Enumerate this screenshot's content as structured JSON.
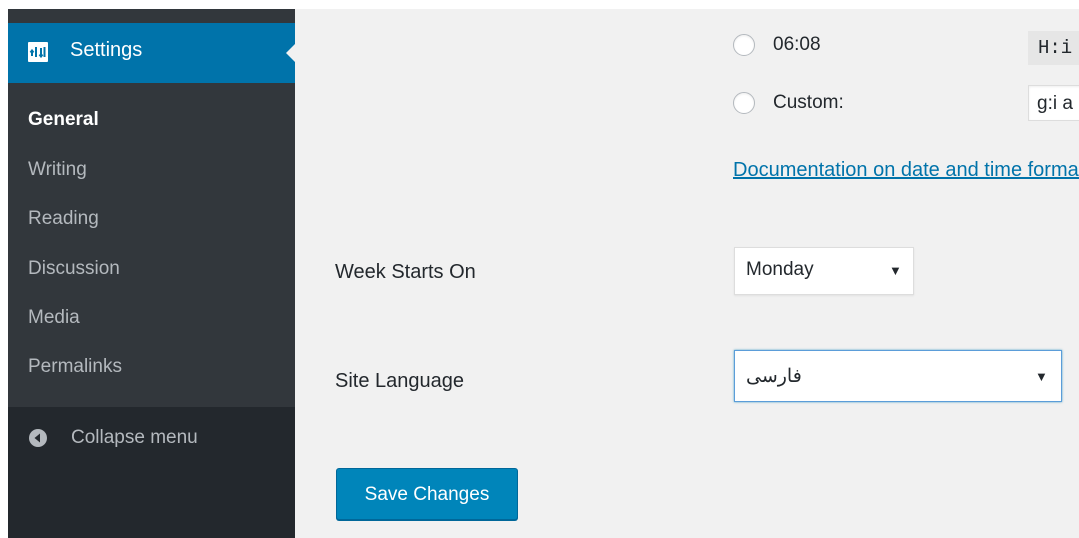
{
  "sidebar": {
    "settings_label": "Settings",
    "settings_icon": "settings-sliders-icon",
    "submenu": [
      {
        "label": "General",
        "current": true
      },
      {
        "label": "Writing",
        "current": false
      },
      {
        "label": "Reading",
        "current": false
      },
      {
        "label": "Discussion",
        "current": false
      },
      {
        "label": "Media",
        "current": false
      },
      {
        "label": "Permalinks",
        "current": false
      }
    ],
    "collapse_label": "Collapse menu",
    "collapse_icon": "collapse-arrow-icon"
  },
  "time_format": {
    "option_0608_label": "06:08",
    "option_0608_code": "H:i",
    "custom_label": "Custom:",
    "custom_value": "g:i a",
    "doc_link": "Documentation on date and time formatting"
  },
  "week_starts_on": {
    "label": "Week Starts On",
    "value": "Monday"
  },
  "site_language": {
    "label": "Site Language",
    "value": "فارسی"
  },
  "save_button": "Save Changes",
  "colors": {
    "accent": "#0073aa",
    "sidebar_bg": "#23282d",
    "submenu_bg": "#32373c",
    "button": "#0085ba"
  }
}
